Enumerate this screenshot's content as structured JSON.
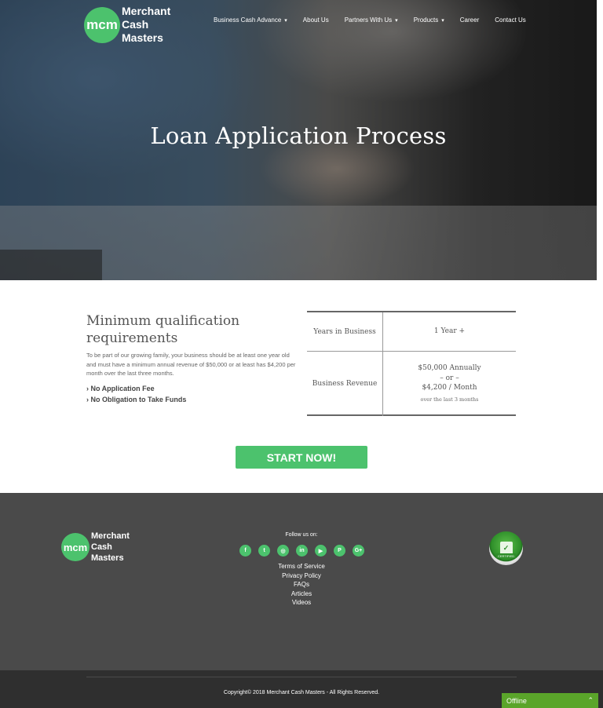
{
  "brand": {
    "mark": "mcm",
    "name_lines": [
      "Merchant",
      "Cash",
      "Masters"
    ],
    "accent": "#4cc26d"
  },
  "nav": [
    {
      "label": "Business Cash Advance",
      "has_dropdown": true
    },
    {
      "label": "About Us",
      "has_dropdown": false
    },
    {
      "label": "Partners With Us",
      "has_dropdown": true
    },
    {
      "label": "Products",
      "has_dropdown": true
    },
    {
      "label": "Career",
      "has_dropdown": false
    },
    {
      "label": "Contact Us",
      "has_dropdown": false
    }
  ],
  "hero": {
    "title": "Loan Application Process"
  },
  "qualification": {
    "title": "Minimum qualification requirements",
    "description": "To be part of our growing family, your business should be at least one year old and must have a minimum annual revenue of $50,000 or at least has $4,200 per month over the last three months.",
    "bullets": [
      "› No Application Fee",
      "› No Obligation to Take Funds"
    ]
  },
  "requirements": {
    "years": {
      "label": "Years in Business",
      "value": "1 Year +"
    },
    "revenue": {
      "label": "Business Revenue",
      "line1": "$50,000 Annually",
      "line2": "– or –",
      "line3": "$4,200 / Month",
      "note": "over the last 3 months"
    }
  },
  "cta": {
    "label": "START NOW!"
  },
  "footer": {
    "follow_label": "Follow us on:",
    "socials": [
      {
        "icon": "facebook-icon",
        "glyph": "f"
      },
      {
        "icon": "twitter-icon",
        "glyph": "t"
      },
      {
        "icon": "instagram-icon",
        "glyph": "◎"
      },
      {
        "icon": "linkedin-icon",
        "glyph": "in"
      },
      {
        "icon": "youtube-icon",
        "glyph": "▶"
      },
      {
        "icon": "pinterest-icon",
        "glyph": "P"
      },
      {
        "icon": "google-plus-icon",
        "glyph": "G+"
      }
    ],
    "links": [
      "Terms of Service",
      "Privacy Policy",
      "FAQs",
      "Articles",
      "Videos"
    ],
    "badge_label": "CERTIFIED",
    "copyright": "Copyright© 2018 Merchant Cash Masters - All Rights Reserved."
  },
  "chat": {
    "status": "Offline",
    "toggle": "⌃"
  }
}
